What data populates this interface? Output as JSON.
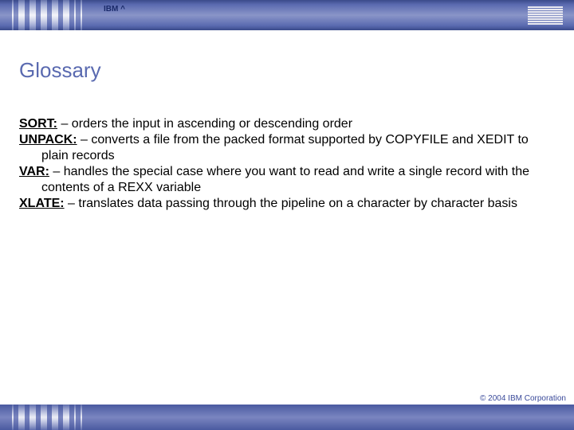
{
  "header": {
    "label": "IBM ^"
  },
  "title": "Glossary",
  "entries": [
    {
      "term": "SORT:",
      "desc": " – orders the input in ascending or descending order"
    },
    {
      "term": "UNPACK:",
      "desc": " – converts a file from the packed format supported by COPYFILE and XEDIT to plain records"
    },
    {
      "term": "VAR:",
      "desc": " – handles the special case where you want to read and write a single record with the contents of a REXX variable"
    },
    {
      "term": "XLATE:",
      "desc": " – translates data passing through the pipeline on a character by character basis"
    }
  ],
  "footer": {
    "copyright": "© 2004 IBM Corporation"
  }
}
